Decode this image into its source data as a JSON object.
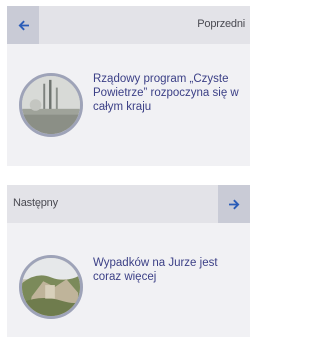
{
  "previous": {
    "label": "Poprzedni",
    "title": "Rządowy program „Czyste Powietrze” rozpoczyna się w całym kraju"
  },
  "next": {
    "label": "Następny",
    "title": "Wypadków na Jurze jest coraz więcej"
  },
  "colors": {
    "arrow": "#2a5cb8",
    "link": "#3b3f86",
    "card_bg": "#f1f1f4",
    "bar_bg": "#e3e3e8",
    "arrow_bg": "#c9cbd6"
  },
  "icons": {
    "previous": "arrow-left-icon",
    "next": "arrow-right-icon"
  }
}
